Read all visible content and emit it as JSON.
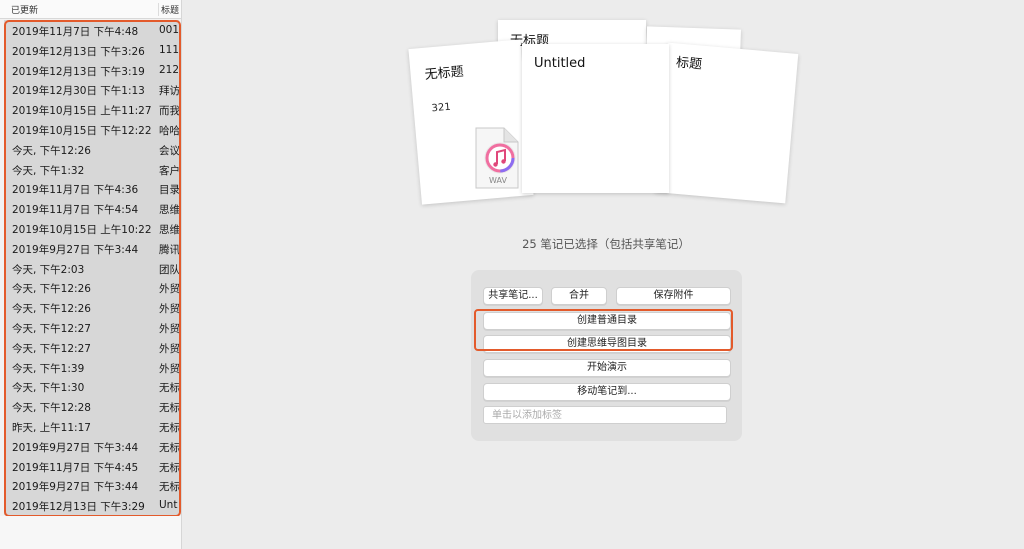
{
  "list": {
    "header_date": "已更新",
    "header_title": "标题",
    "rows": [
      {
        "date": "2019年11月7日 下午4:48",
        "title": "001"
      },
      {
        "date": "2019年12月13日 下午3:26",
        "title": "111"
      },
      {
        "date": "2019年12月13日 下午3:19",
        "title": "212"
      },
      {
        "date": "2019年12月30日 下午1:13",
        "title": "拜访"
      },
      {
        "date": "2019年10月15日 上午11:27",
        "title": "而我"
      },
      {
        "date": "2019年10月15日 下午12:22",
        "title": "哈哈"
      },
      {
        "date": "今天, 下午12:26",
        "title": "会议"
      },
      {
        "date": "今天, 下午1:32",
        "title": "客户"
      },
      {
        "date": "2019年11月7日 下午4:36",
        "title": "目录"
      },
      {
        "date": "2019年11月7日 下午4:54",
        "title": "思维"
      },
      {
        "date": "2019年10月15日 上午10:22",
        "title": "思维"
      },
      {
        "date": "2019年9月27日 下午3:44",
        "title": "腾讯"
      },
      {
        "date": "今天, 下午2:03",
        "title": "团队"
      },
      {
        "date": "今天, 下午12:26",
        "title": "外贸"
      },
      {
        "date": "今天, 下午12:26",
        "title": "外贸"
      },
      {
        "date": "今天, 下午12:27",
        "title": "外贸"
      },
      {
        "date": "今天, 下午12:27",
        "title": "外贸"
      },
      {
        "date": "今天, 下午1:39",
        "title": "外贸"
      },
      {
        "date": "今天, 下午1:30",
        "title": "无标"
      },
      {
        "date": "今天, 下午12:28",
        "title": "无标"
      },
      {
        "date": "昨天, 上午11:17",
        "title": "无标"
      },
      {
        "date": "2019年9月27日 下午3:44",
        "title": "无标"
      },
      {
        "date": "2019年11月7日 下午4:45",
        "title": "无标"
      },
      {
        "date": "2019年9月27日 下午3:44",
        "title": "无标"
      },
      {
        "date": "2019年12月13日 下午3:29",
        "title": "Unt"
      }
    ]
  },
  "preview": {
    "card_back1_title": "无标题",
    "card_left_title": "无标题",
    "card_left_body": "321",
    "card_center_title": "Untitled",
    "card_right_title": "标题",
    "wav_label": "WAV"
  },
  "selection_label": "25 笔记已选择（包括共享笔记）",
  "actions": {
    "share": "共享笔记...",
    "merge": "合并",
    "save_attachments": "保存附件",
    "create_toc": "创建普通目录",
    "create_mindmap_toc": "创建思维导图目录",
    "present": "开始演示",
    "move": "移动笔记到...",
    "tag_placeholder": "单击以添加标签"
  },
  "colors": {
    "highlight": "#e35a2b"
  }
}
